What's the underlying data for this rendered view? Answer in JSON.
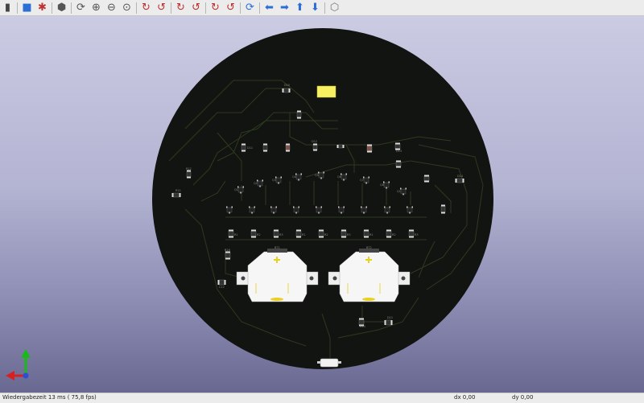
{
  "toolbar": {
    "items": [
      {
        "name": "render-icon",
        "color": "#444"
      },
      {
        "sep": true
      },
      {
        "name": "board-body-icon",
        "color": "#2b6fd6"
      },
      {
        "name": "raytracing-icon",
        "color": "#c03030"
      },
      {
        "sep": true
      },
      {
        "name": "3d-cube-icon",
        "color": "#555"
      },
      {
        "sep": true
      },
      {
        "name": "reload-icon",
        "color": "#555"
      },
      {
        "name": "zoom-in-icon",
        "color": "#555"
      },
      {
        "name": "zoom-out-icon",
        "color": "#555"
      },
      {
        "name": "zoom-fit-icon",
        "color": "#555"
      },
      {
        "sep": true
      },
      {
        "name": "rotate-x-cw-icon",
        "color": "#c03030"
      },
      {
        "name": "rotate-x-ccw-icon",
        "color": "#c03030"
      },
      {
        "sep": true
      },
      {
        "name": "rotate-y-cw-icon",
        "color": "#c03030"
      },
      {
        "name": "rotate-y-ccw-icon",
        "color": "#c03030"
      },
      {
        "sep": true
      },
      {
        "name": "rotate-z-cw-icon",
        "color": "#c03030"
      },
      {
        "name": "rotate-z-ccw-icon",
        "color": "#c03030"
      },
      {
        "sep": true
      },
      {
        "name": "flip-board-icon",
        "color": "#2b6fd6"
      },
      {
        "sep": true
      },
      {
        "name": "move-left-icon",
        "color": "#2b6fd6"
      },
      {
        "name": "move-right-icon",
        "color": "#2b6fd6"
      },
      {
        "name": "move-up-icon",
        "color": "#2b6fd6"
      },
      {
        "name": "move-down-icon",
        "color": "#2b6fd6"
      },
      {
        "sep": true
      },
      {
        "name": "view-orthographic-icon",
        "color": "#777"
      }
    ]
  },
  "board": {
    "color": "#111411",
    "copper_color": "#2e3a1e",
    "batteries": [
      {
        "ref": "BT1"
      },
      {
        "ref": "BT2"
      }
    ],
    "labels": [
      "D10",
      "D11",
      "D12",
      "D13",
      "D14",
      "R12",
      "R14",
      "R16",
      "R11",
      "C12",
      "Q1",
      "Q2",
      "Q3",
      "Q4",
      "Q5",
      "Q6",
      "Q7",
      "Q8",
      "R1",
      "R2",
      "R3",
      "C1",
      "C2",
      "SW1"
    ]
  },
  "status": {
    "render_time": "Wiedergabezeit 13 ms ( 75,8 fps)",
    "dx": "dx 0,00",
    "dy": "dy 0,00"
  }
}
